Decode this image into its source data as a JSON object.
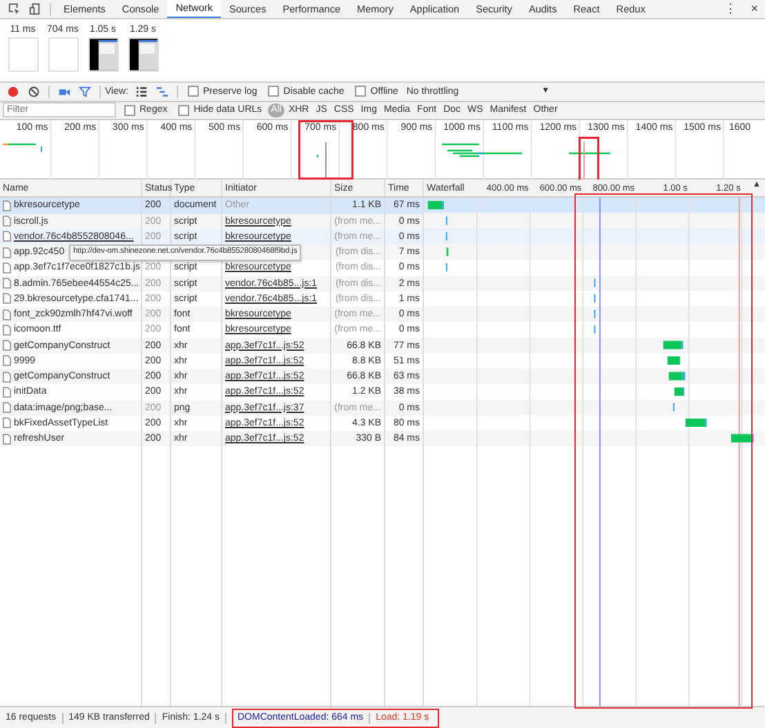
{
  "tabs": [
    {
      "label": "Elements",
      "selected": false
    },
    {
      "label": "Console",
      "selected": false
    },
    {
      "label": "Network",
      "selected": true
    },
    {
      "label": "Sources",
      "selected": false
    },
    {
      "label": "Performance",
      "selected": false
    },
    {
      "label": "Memory",
      "selected": false
    },
    {
      "label": "Application",
      "selected": false
    },
    {
      "label": "Security",
      "selected": false
    },
    {
      "label": "Audits",
      "selected": false
    },
    {
      "label": "React",
      "selected": false
    },
    {
      "label": "Redux",
      "selected": false
    }
  ],
  "more_menu": "⋮",
  "close": "×",
  "filmstrip": [
    {
      "time": "11 ms",
      "kind": "blank"
    },
    {
      "time": "704 ms",
      "kind": "blank"
    },
    {
      "time": "1.05 s",
      "kind": "page"
    },
    {
      "time": "1.29 s",
      "kind": "page"
    }
  ],
  "toolbar": {
    "view_label": "View:",
    "options": [
      {
        "label": "Preserve log",
        "checked": false
      },
      {
        "label": "Disable cache",
        "checked": false
      },
      {
        "label": "Offline",
        "checked": false
      }
    ],
    "throttling": "No throttling",
    "caret": "▼"
  },
  "filter_bar": {
    "placeholder": "Filter",
    "options": [
      {
        "label": "Regex",
        "checked": false
      },
      {
        "label": "Hide data URLs",
        "checked": false
      }
    ],
    "types": [
      {
        "label": "All",
        "selected": true
      },
      {
        "label": "XHR",
        "selected": false
      },
      {
        "label": "JS",
        "selected": false
      },
      {
        "label": "CSS",
        "selected": false
      },
      {
        "label": "Img",
        "selected": false
      },
      {
        "label": "Media",
        "selected": false
      },
      {
        "label": "Font",
        "selected": false
      },
      {
        "label": "Doc",
        "selected": false
      },
      {
        "label": "WS",
        "selected": false
      },
      {
        "label": "Manifest",
        "selected": false
      },
      {
        "label": "Other",
        "selected": false
      }
    ]
  },
  "overview_ticks": [
    "100 ms",
    "200 ms",
    "300 ms",
    "400 ms",
    "500 ms",
    "600 ms",
    "700 ms",
    "800 ms",
    "900 ms",
    "1000 ms",
    "1100 ms",
    "1200 ms",
    "1300 ms",
    "1400 ms",
    "1500 ms",
    "1600"
  ],
  "table": {
    "columns": [
      "Name",
      "Status",
      "Type",
      "Initiator",
      "Size",
      "Time",
      "Waterfall"
    ],
    "sort_arrow": "▲",
    "rows": [
      {
        "name": "bkresourcetype",
        "status": "200",
        "type": "document",
        "initiator": "Other",
        "initiator_link": false,
        "size": "1.1 KB",
        "time": "67 ms",
        "cached": false,
        "selected": true,
        "hovered": false
      },
      {
        "name": "iscroll.js",
        "status": "200",
        "type": "script",
        "initiator": "bkresourcetype",
        "initiator_link": true,
        "size": "(from me...",
        "time": "0 ms",
        "cached": true,
        "selected": false,
        "hovered": false
      },
      {
        "name": "vendor.76c4b8552808046...",
        "status": "200",
        "type": "script",
        "initiator": "bkresourcetype",
        "initiator_link": true,
        "size": "(from me...",
        "time": "0 ms",
        "cached": true,
        "selected": false,
        "hovered": true
      },
      {
        "name": "app.92c450",
        "size": "(from dis...",
        "time": "7 ms",
        "cached": true,
        "selected": false,
        "hovered": false
      },
      {
        "name": "app.3ef7c1f7ece0f1827c1b.js",
        "status": "200",
        "type": "script",
        "initiator": "bkresourcetype",
        "initiator_link": true,
        "size": "(from dis...",
        "time": "0 ms",
        "cached": true,
        "selected": false,
        "hovered": false
      },
      {
        "name": "8.admin.765ebee44554c25...",
        "status": "200",
        "type": "script",
        "initiator": "vendor.76c4b85...js:1",
        "initiator_link": true,
        "size": "(from dis...",
        "time": "2 ms",
        "cached": true,
        "selected": false,
        "hovered": false
      },
      {
        "name": "29.bkresourcetype.cfa1741...",
        "status": "200",
        "type": "script",
        "initiator": "vendor.76c4b85...js:1",
        "initiator_link": true,
        "size": "(from dis...",
        "time": "1 ms",
        "cached": true,
        "selected": false,
        "hovered": false
      },
      {
        "name": "font_zck90zmlh7hf47vi.woff",
        "status": "200",
        "type": "font",
        "initiator": "bkresourcetype",
        "initiator_link": true,
        "size": "(from me...",
        "time": "0 ms",
        "cached": true,
        "selected": false,
        "hovered": false
      },
      {
        "name": "icomoon.ttf",
        "status": "200",
        "type": "font",
        "initiator": "bkresourcetype",
        "initiator_link": true,
        "size": "(from me...",
        "time": "0 ms",
        "cached": true,
        "selected": false,
        "hovered": false
      },
      {
        "name": "getCompanyConstruct",
        "status": "200",
        "type": "xhr",
        "initiator": "app.3ef7c1f...js:52",
        "initiator_link": true,
        "size": "66.8 KB",
        "time": "77 ms",
        "cached": false,
        "selected": false,
        "hovered": false
      },
      {
        "name": "9999",
        "status": "200",
        "type": "xhr",
        "initiator": "app.3ef7c1f...js:52",
        "initiator_link": true,
        "size": "8.8 KB",
        "time": "51 ms",
        "cached": false,
        "selected": false,
        "hovered": false
      },
      {
        "name": "getCompanyConstruct",
        "status": "200",
        "type": "xhr",
        "initiator": "app.3ef7c1f...js:52",
        "initiator_link": true,
        "size": "66.8 KB",
        "time": "63 ms",
        "cached": false,
        "selected": false,
        "hovered": false
      },
      {
        "name": "initData",
        "status": "200",
        "type": "xhr",
        "initiator": "app.3ef7c1f...js:52",
        "initiator_link": true,
        "size": "1.2 KB",
        "time": "38 ms",
        "cached": false,
        "selected": false,
        "hovered": false
      },
      {
        "name": "data:image/png;base...",
        "status": "200",
        "type": "png",
        "initiator": "app.3ef7c1f...js:37",
        "initiator_link": true,
        "size": "(from me...",
        "time": "0 ms",
        "cached": true,
        "selected": false,
        "hovered": false
      },
      {
        "name": "bkFixedAssetTypeList",
        "status": "200",
        "type": "xhr",
        "initiator": "app.3ef7c1f...js:52",
        "initiator_link": true,
        "size": "4.3 KB",
        "time": "80 ms",
        "cached": false,
        "selected": false,
        "hovered": false
      },
      {
        "name": "refreshUser",
        "status": "200",
        "type": "xhr",
        "initiator": "app.3ef7c1f...js:52",
        "initiator_link": true,
        "size": "330 B",
        "time": "84 ms",
        "cached": false,
        "selected": false,
        "hovered": false
      }
    ],
    "tooltip": "http://dev-om.shinezone.net.cn/vendor.76c4b85528080468f9bd.js",
    "waterfall_ticks": [
      "400.00 ms",
      "600.00 ms",
      "800.00 ms",
      "1.00 s",
      "1.20 s"
    ]
  },
  "status_bar": [
    {
      "text": "16 requests",
      "kind": "plain"
    },
    {
      "text": "149 KB transferred",
      "kind": "plain"
    },
    {
      "text": "Finish: 1.24 s",
      "kind": "plain"
    },
    {
      "text": "DOMContentLoaded: 664 ms",
      "kind": "dom"
    },
    {
      "text": "Load: 1.19 s",
      "kind": "load"
    }
  ]
}
